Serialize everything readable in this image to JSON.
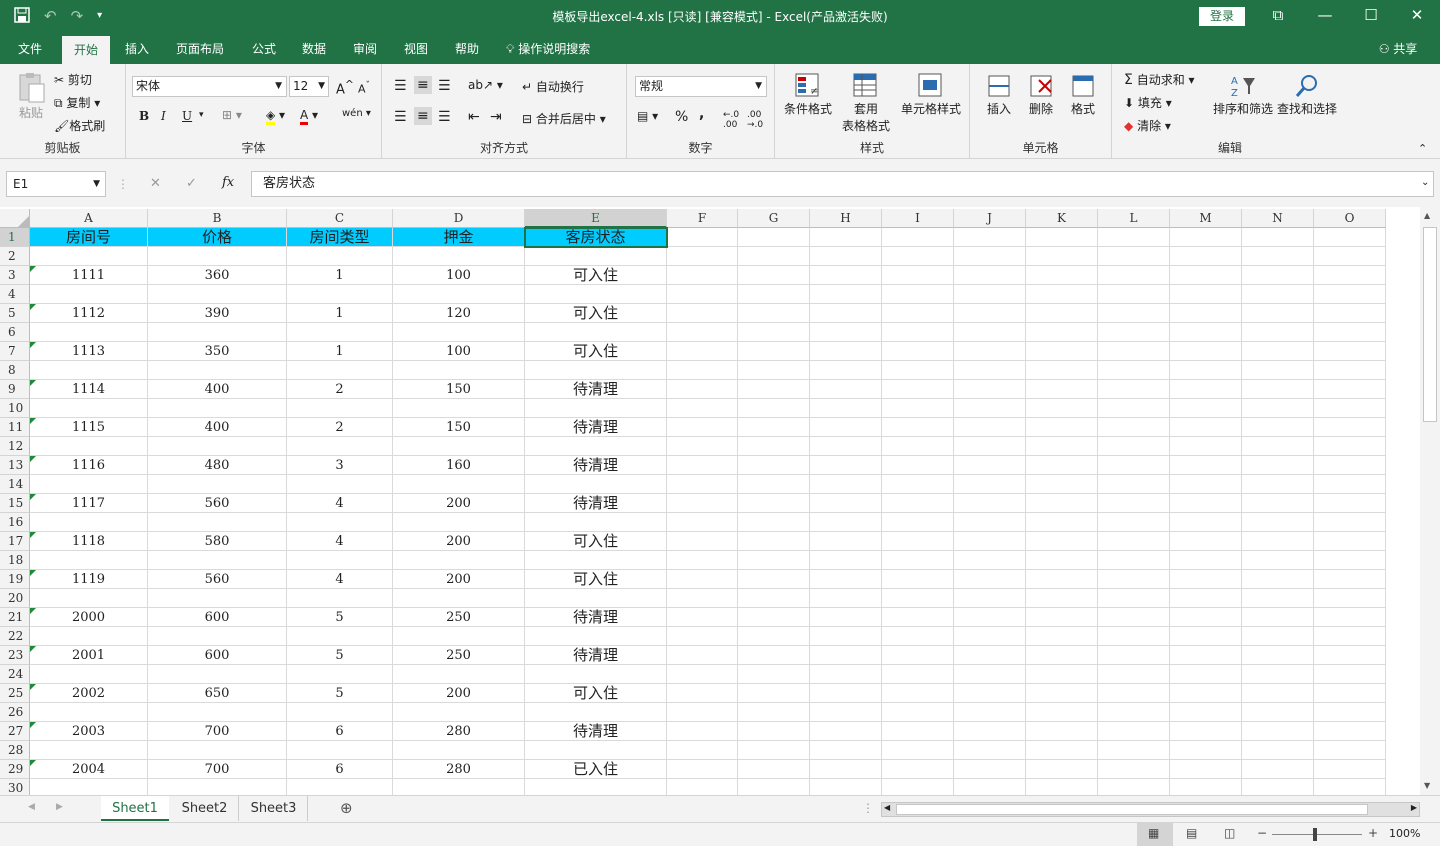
{
  "window": {
    "title": "模板导出excel-4.xls  [只读]  [兼容模式]  -  Excel(产品激活失败)",
    "login_label": "登录",
    "share_label": "共享"
  },
  "tabs": [
    {
      "label": "文件"
    },
    {
      "label": "开始"
    },
    {
      "label": "插入"
    },
    {
      "label": "页面布局"
    },
    {
      "label": "公式"
    },
    {
      "label": "数据"
    },
    {
      "label": "审阅"
    },
    {
      "label": "视图"
    },
    {
      "label": "帮助"
    }
  ],
  "tell_me": "操作说明搜索",
  "ribbon": {
    "clipboard": {
      "label": "剪贴板",
      "paste": "粘贴",
      "cut": "剪切",
      "copy": "复制",
      "format_painter": "格式刷"
    },
    "font": {
      "label": "字体",
      "font_name": "宋体",
      "font_size": "12",
      "bold": "B",
      "italic": "I",
      "underline": "U",
      "wen": "wén"
    },
    "alignment": {
      "label": "对齐方式",
      "wrap": "自动换行",
      "merge": "合并后居中"
    },
    "number": {
      "label": "数字",
      "format": "常规",
      "percent": "%",
      "comma": ","
    },
    "styles": {
      "label": "样式",
      "conditional": "条件格式",
      "table1": "套用",
      "table2": "表格格式",
      "cell_styles": "单元格样式"
    },
    "cells": {
      "label": "单元格",
      "insert": "插入",
      "delete": "删除",
      "format": "格式"
    },
    "editing": {
      "label": "编辑",
      "autosum": "自动求和",
      "fill": "填充",
      "clear": "清除",
      "sort": "排序和筛选",
      "find": "查找和选择"
    }
  },
  "formula_bar": {
    "name_box": "E1",
    "fx": "fx",
    "content": "客房状态"
  },
  "columns": [
    "A",
    "B",
    "C",
    "D",
    "E",
    "F",
    "G",
    "H",
    "I",
    "J",
    "K",
    "L",
    "M",
    "N",
    "O"
  ],
  "row_numbers": [
    "1",
    "2",
    "3",
    "4",
    "5",
    "6",
    "7",
    "8",
    "9",
    "10",
    "11",
    "12",
    "13",
    "14",
    "15",
    "16",
    "17",
    "18",
    "19",
    "20",
    "21",
    "22",
    "23",
    "24",
    "25",
    "26",
    "27",
    "28",
    "29",
    "30"
  ],
  "headers": [
    "房间号",
    "价格",
    "房间类型",
    "押金",
    "客房状态"
  ],
  "rows": [
    [
      "1111",
      "360",
      "1",
      "100",
      "可入住"
    ],
    [
      "1112",
      "390",
      "1",
      "120",
      "可入住"
    ],
    [
      "1113",
      "350",
      "1",
      "100",
      "可入住"
    ],
    [
      "1114",
      "400",
      "2",
      "150",
      "待清理"
    ],
    [
      "1115",
      "400",
      "2",
      "150",
      "待清理"
    ],
    [
      "1116",
      "480",
      "3",
      "160",
      "待清理"
    ],
    [
      "1117",
      "560",
      "4",
      "200",
      "待清理"
    ],
    [
      "1118",
      "580",
      "4",
      "200",
      "可入住"
    ],
    [
      "1119",
      "560",
      "4",
      "200",
      "可入住"
    ],
    [
      "2000",
      "600",
      "5",
      "250",
      "待清理"
    ],
    [
      "2001",
      "600",
      "5",
      "250",
      "待清理"
    ],
    [
      "2002",
      "650",
      "5",
      "200",
      "可入住"
    ],
    [
      "2003",
      "700",
      "6",
      "280",
      "待清理"
    ],
    [
      "2004",
      "700",
      "6",
      "280",
      "已入住"
    ]
  ],
  "sheets": [
    {
      "label": "Sheet1"
    },
    {
      "label": "Sheet2"
    },
    {
      "label": "Sheet3"
    }
  ],
  "status": {
    "zoom": "100%"
  }
}
